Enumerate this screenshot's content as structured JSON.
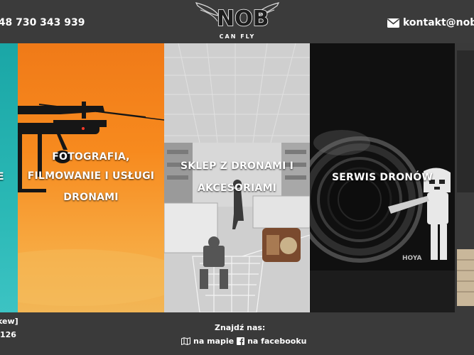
{
  "header": {
    "phone": "+48 730 343 939",
    "logo_text": "NOB",
    "logo_sub": "CAN FLY",
    "email": "kontakt@nob"
  },
  "panels": [
    {
      "title": "E",
      "icon": "teal-panel"
    },
    {
      "title_lines": [
        "FOTOGRAFIA,",
        "FILMOWANIE I USŁUGI",
        "DRONAMI"
      ],
      "icon": "drone-image"
    },
    {
      "title_lines": [
        "SKLEP Z DRONAMI I",
        "AKCESORIAMI"
      ],
      "icon": "store-image"
    },
    {
      "title": "SERWIS DRONÓW",
      "icon": "camera-lens-image"
    },
    {
      "title": "",
      "icon": "dark-panel"
    }
  ],
  "footer": {
    "left_line1": "kew]",
    "left_line2": "126",
    "find_us": "Znajdź nas:",
    "map_link": "na mapie",
    "facebook_link": "na facebooku"
  },
  "colors": {
    "topbar": "#3b3b3b",
    "footer": "#3a3a3a",
    "text": "#ffffff"
  }
}
